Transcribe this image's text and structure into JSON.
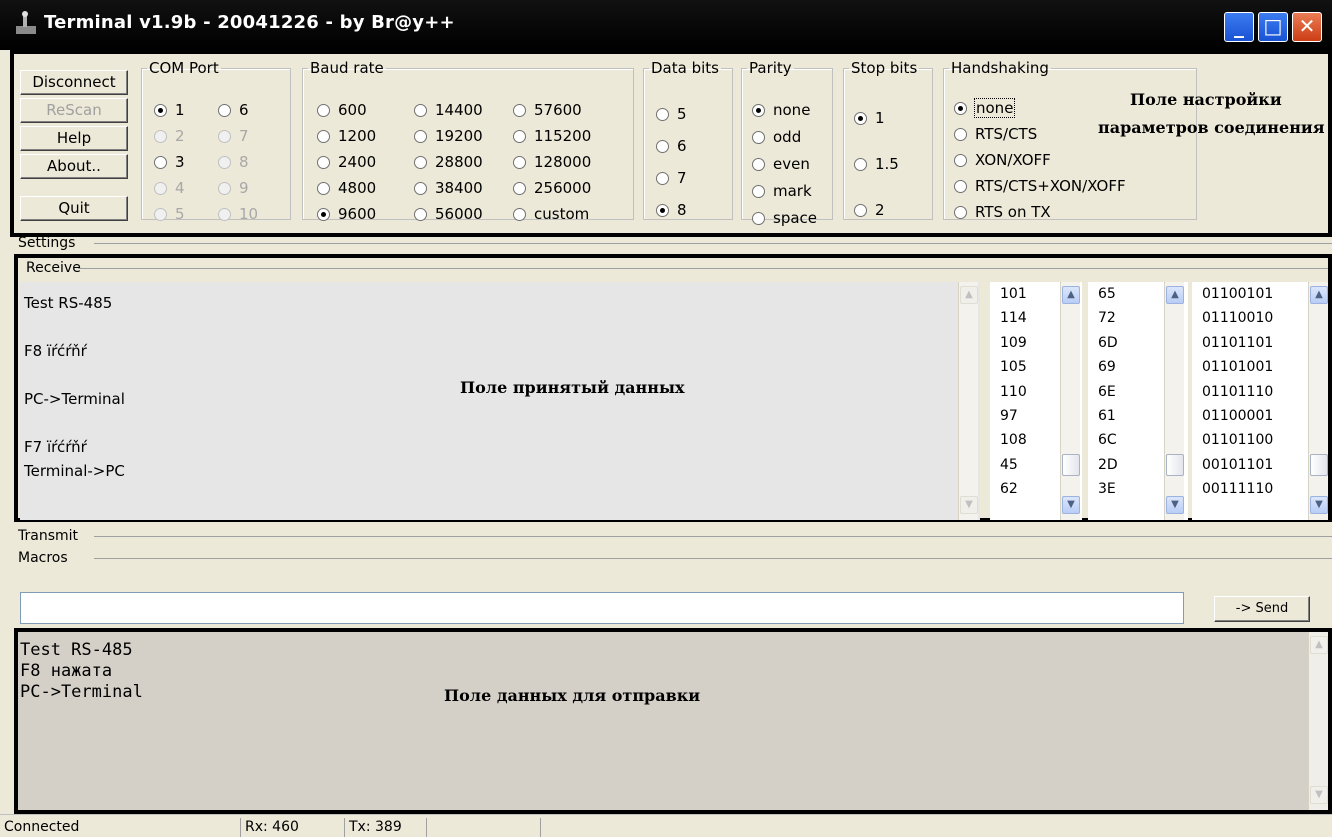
{
  "window": {
    "title": "Terminal v1.9b - 20041226 - by Br@y++",
    "minimize_glyph": "_",
    "maximize_glyph": "□",
    "close_glyph": "✕"
  },
  "buttons": {
    "disconnect": "Disconnect",
    "rescan": "ReScan",
    "help": "Help",
    "about": "About..",
    "quit": "Quit"
  },
  "com_port": {
    "label": "COM Port",
    "options": [
      "1",
      "2",
      "3",
      "4",
      "5",
      "6",
      "7",
      "8",
      "9",
      "10"
    ],
    "selected": "1"
  },
  "baud_rate": {
    "label": "Baud rate",
    "options": [
      "600",
      "1200",
      "2400",
      "4800",
      "9600",
      "14400",
      "19200",
      "28800",
      "38400",
      "56000",
      "57600",
      "115200",
      "128000",
      "256000",
      "custom"
    ],
    "selected": "9600"
  },
  "data_bits": {
    "label": "Data bits",
    "options": [
      "5",
      "6",
      "7",
      "8"
    ],
    "selected": "8"
  },
  "parity": {
    "label": "Parity",
    "options": [
      "none",
      "odd",
      "even",
      "mark",
      "space"
    ],
    "selected": "none"
  },
  "stop_bits": {
    "label": "Stop bits",
    "options": [
      "1",
      "1.5",
      "2"
    ],
    "selected": "1"
  },
  "handshaking": {
    "label": "Handshaking",
    "options": [
      "none",
      "RTS/CTS",
      "XON/XOFF",
      "RTS/CTS+XON/XOFF",
      "RTS on TX"
    ],
    "selected": "none"
  },
  "notes": {
    "settings_line1": "Поле настройки",
    "settings_line2": "параметров соединения",
    "receive": "Поле принятый данных",
    "send": "Поле данных для отправки"
  },
  "sections": {
    "settings": "Settings",
    "receive": "Receive",
    "transmit": "Transmit",
    "macros": "Macros"
  },
  "receive": {
    "text_lines": [
      "Test RS-485",
      "F8 ïŕćŕňŕ",
      "PC->Terminal",
      "F7 ïŕćŕňŕ",
      "Terminal->PC"
    ],
    "dec": [
      "101",
      "114",
      "109",
      "105",
      "110",
      "97",
      "108",
      "45",
      "62"
    ],
    "hex": [
      "65",
      "72",
      "6D",
      "69",
      "6E",
      "61",
      "6C",
      "2D",
      "3E"
    ],
    "bin": [
      "01100101",
      "01110010",
      "01101101",
      "01101001",
      "01101110",
      "01100001",
      "01101100",
      "00101101",
      "00111110"
    ]
  },
  "transmit": {
    "input_value": "",
    "send_label": "-> Send",
    "log_lines": [
      "Test RS-485",
      "F8 нажата",
      "PC->Terminal"
    ]
  },
  "statusbar": {
    "state": "Connected",
    "rx": "Rx: 460",
    "tx": "Tx: 389"
  },
  "colors": {
    "face": "#ece9d8",
    "title_bg": "#000000",
    "log_bg": "#d4d0c8"
  }
}
